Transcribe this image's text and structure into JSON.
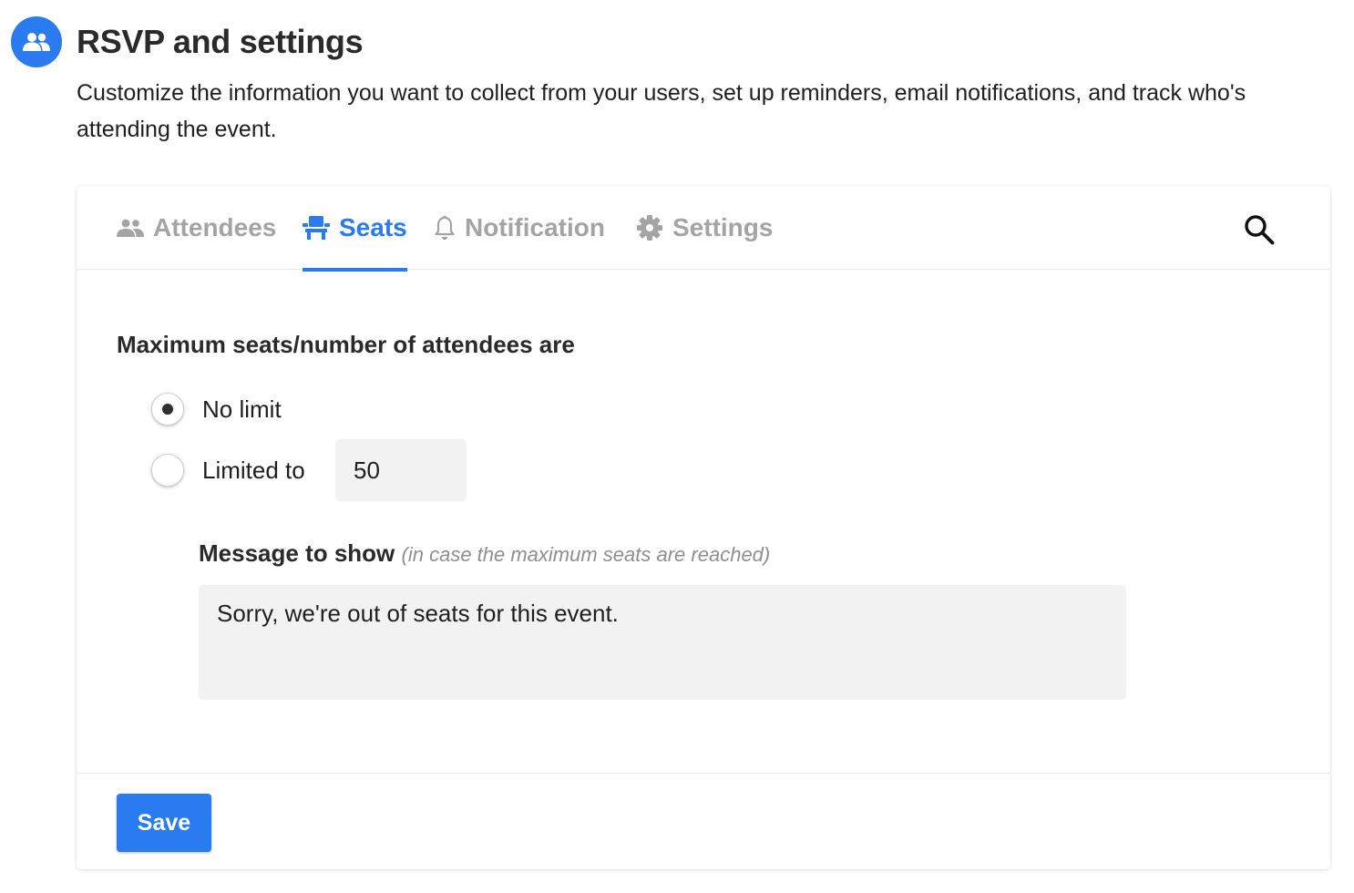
{
  "header": {
    "icon": "people-icon",
    "title": "RSVP and settings",
    "description": "Customize the information you want to collect from your users, set up reminders, email notifications, and track who's attending the event."
  },
  "tabs": [
    {
      "label": "Attendees",
      "icon": "people-icon",
      "active": false
    },
    {
      "label": "Seats",
      "icon": "seat-icon",
      "active": true
    },
    {
      "label": "Notification",
      "icon": "bell-icon",
      "active": false
    },
    {
      "label": "Settings",
      "icon": "gear-icon",
      "active": false
    }
  ],
  "search": {
    "icon": "search-icon"
  },
  "seats": {
    "section_title": "Maximum seats/number of attendees are",
    "options": [
      {
        "label": "No limit",
        "selected": true
      },
      {
        "label": "Limited to",
        "selected": false
      }
    ],
    "limit_value": "50",
    "message_label": "Message to show",
    "message_hint": "(in case the maximum seats are reached)",
    "message_value": "Sorry, we're out of seats for this event."
  },
  "footer": {
    "save_label": "Save"
  },
  "colors": {
    "accent": "#2b7bf0",
    "inactive_tab": "#a4a4a4",
    "input_bg": "#f1f2f1"
  }
}
